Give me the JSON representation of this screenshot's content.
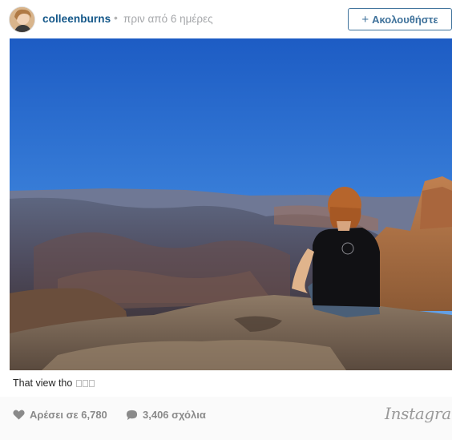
{
  "post": {
    "username": "colleenburns",
    "separator": "•",
    "timestamp": "πριν από 6 ημέρες",
    "follow_label": "Ακολουθήστε",
    "caption": "That view tho",
    "likes": "Αρέσει σε 6,780",
    "comments": "3,406 σχόλια",
    "brand": "Instagram"
  },
  "colors": {
    "username": "#125688",
    "follow_button": "#3f729b",
    "meta_text": "#8a8a8a"
  },
  "icons": {
    "follow": "plus-icon",
    "likes": "heart-icon",
    "comments": "comment-bubble-icon"
  }
}
